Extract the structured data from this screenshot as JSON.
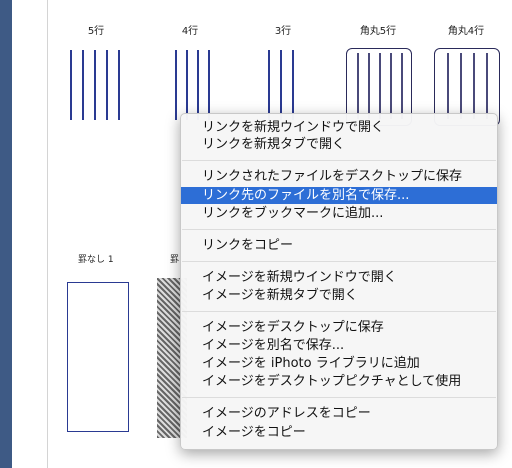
{
  "columns": [
    "5行",
    "4行",
    "3行",
    "角丸5行",
    "角丸4行"
  ],
  "lower": {
    "label1": "罫なし 1",
    "label2": "罫"
  },
  "context_menu": {
    "group1": [
      "リンクを新規ウインドウで開く",
      "リンクを新規タブで開く"
    ],
    "group2": [
      "リンクされたファイルをデスクトップに保存",
      "リンク先のファイルを別名で保存...",
      "リンクをブックマークに追加..."
    ],
    "group3": [
      "リンクをコピー"
    ],
    "group4": [
      "イメージを新規ウインドウで開く",
      "イメージを新規タブで開く"
    ],
    "group5": [
      "イメージをデスクトップに保存",
      "イメージを別名で保存...",
      "イメージを iPhoto ライブラリに追加",
      "イメージをデスクトップピクチャとして使用"
    ],
    "group6": [
      "イメージのアドレスをコピー",
      "イメージをコピー"
    ],
    "selected": "リンク先のファイルを別名で保存..."
  },
  "colors": {
    "sidebar": "#3e5a85",
    "selection": "#2d6ed6",
    "rule_lines": "#2a3a92"
  }
}
